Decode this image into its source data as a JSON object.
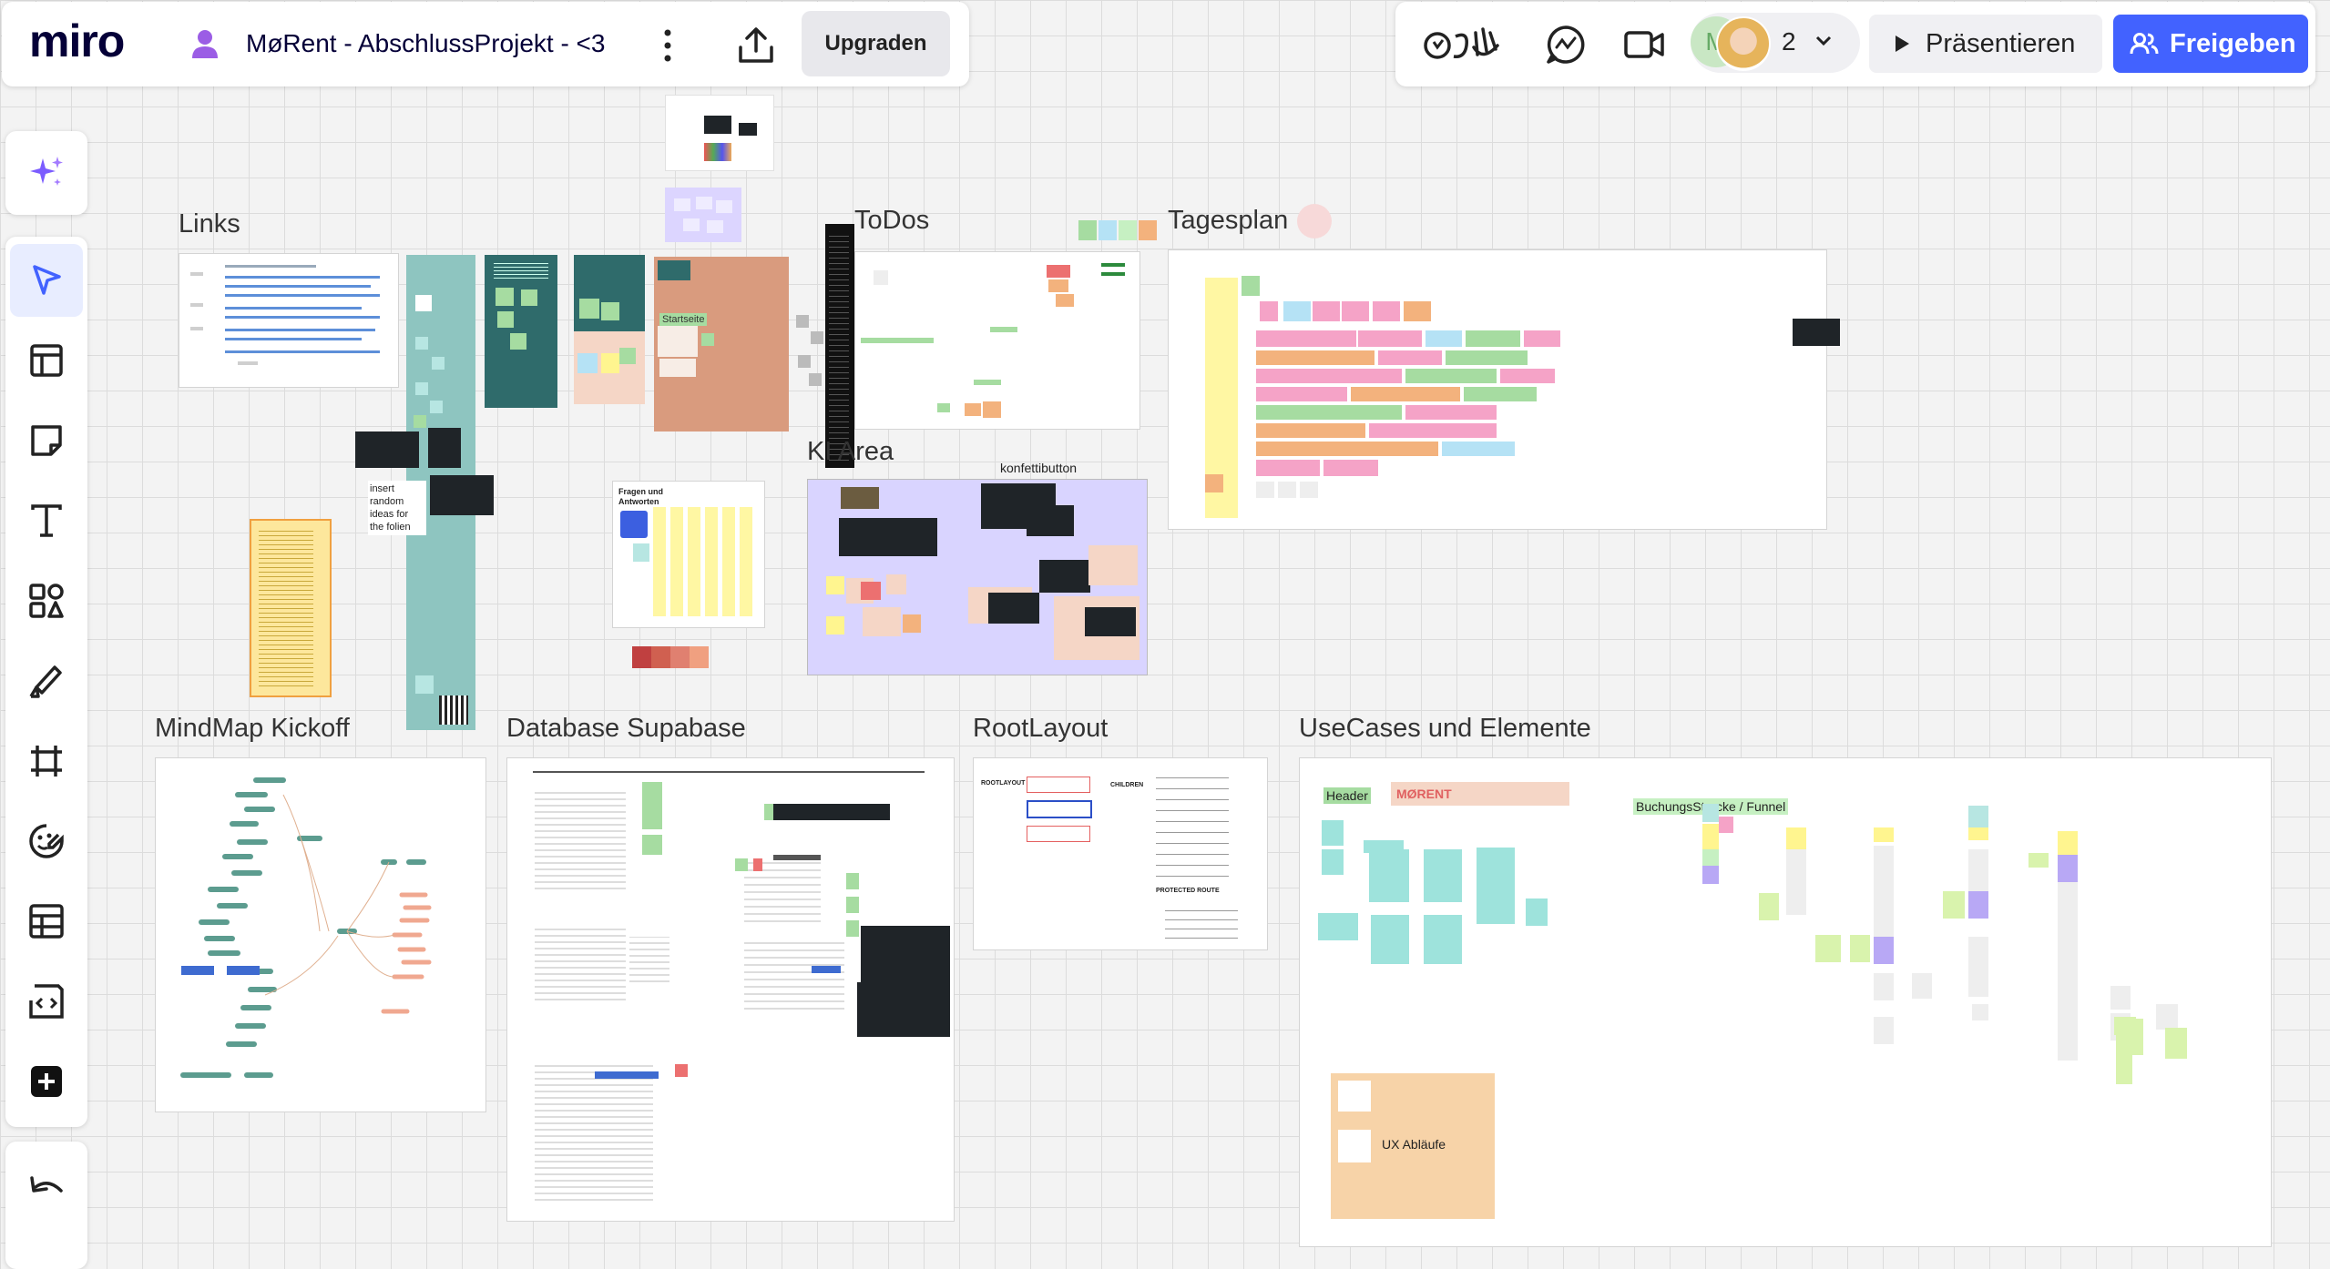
{
  "app": {
    "logo": "miro",
    "board_title": "MøRent - AbschlussProjekt - <3",
    "upgrade_label": "Upgraden",
    "collaborator_count": "2",
    "avatar_initial": "M",
    "present_label": "Präsentieren",
    "share_label": "Freigeben",
    "accent_color": "#4262ff"
  },
  "toolbar": {
    "icons": [
      "ai-sparkle-icon",
      "select-cursor-icon",
      "templates-icon",
      "sticky-note-icon",
      "text-icon",
      "shapes-icon",
      "pen-icon",
      "frame-icon",
      "stickers-icon",
      "table-icon",
      "embed-code-icon",
      "add-more-icon",
      "undo-icon"
    ]
  },
  "frames": {
    "links": "Links",
    "todos": "ToDos",
    "tagesplan": "Tagesplan",
    "ki_area": "KI Area",
    "mindmap": "MindMap Kickoff",
    "database": "Database Supabase",
    "rootlayout": "RootLayout",
    "usecases": "UseCases und Elemente"
  },
  "labels": {
    "konfettibutton": "konfettibutton",
    "insert_ideas": "insert random ideas for the folien",
    "fragen": "Fragen und Antworten",
    "startseite": "Startseite",
    "header": "Header",
    "morent": "MØRENT",
    "buchung": "BuchungsStrecke / Funnel",
    "ux": "UX Abläufe",
    "rootlayout_small": "ROOTLAYOUT",
    "children": "CHILDREN",
    "protected": "PROTECTED ROUTE"
  }
}
